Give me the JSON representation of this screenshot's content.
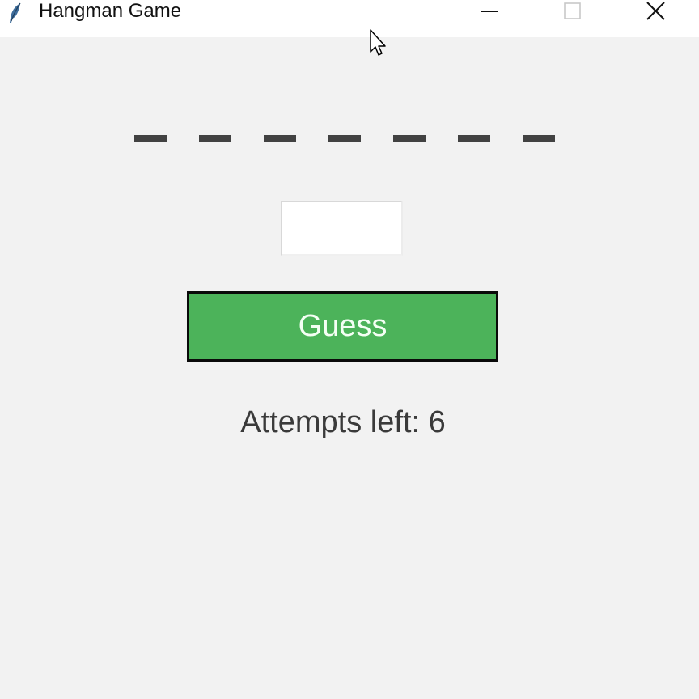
{
  "window": {
    "title": "Hangman Game",
    "app_icon": "feather-icon",
    "controls": [
      "minimize-icon",
      "maximize-icon",
      "close-icon"
    ]
  },
  "game": {
    "word_slots": [
      "_",
      "_",
      "_",
      "_",
      "_",
      "_",
      "_"
    ],
    "guess_input_value": "",
    "guess_button_label": "Guess",
    "attempts_text": "Attempts left: 6"
  },
  "colors": {
    "button_bg": "#4cb35a",
    "button_border": "#0a0a0a",
    "dash": "#424242",
    "background": "#f2f2f2"
  }
}
